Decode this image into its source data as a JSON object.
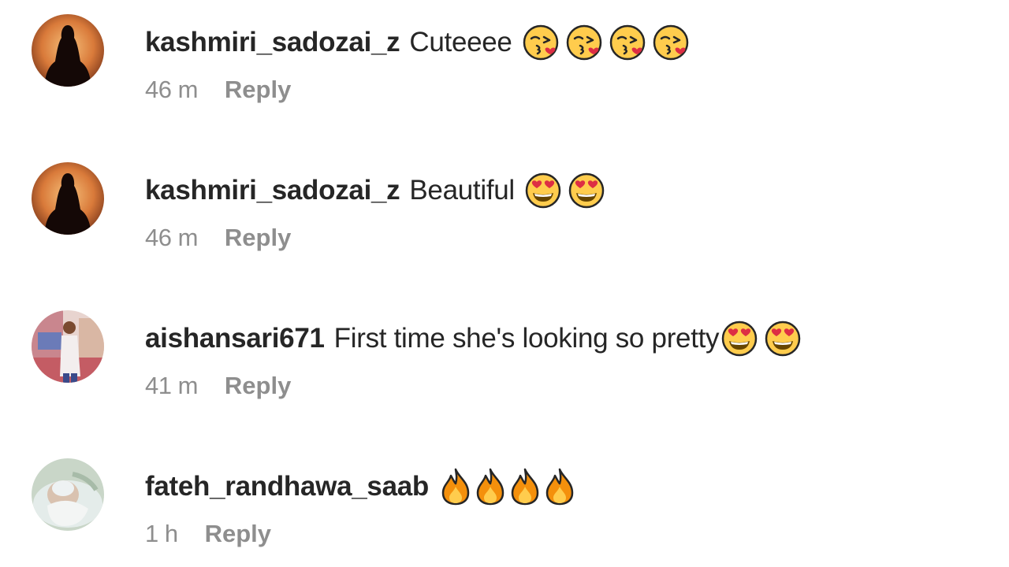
{
  "comments": [
    {
      "username": "kashmiri_sadozai_z",
      "text": "Cuteeee",
      "emoji": "kissing-heart",
      "emoji_count": 4,
      "time": "46 m",
      "reply_label": "Reply"
    },
    {
      "username": "kashmiri_sadozai_z",
      "text": "Beautiful",
      "emoji": "heart-eyes",
      "emoji_count": 2,
      "time": "46 m",
      "reply_label": "Reply"
    },
    {
      "username": "aishansari671",
      "text": "First time she's looking so pretty",
      "emoji": "heart-eyes",
      "emoji_count": 2,
      "time": "41 m",
      "reply_label": "Reply"
    },
    {
      "username": "fateh_randhawa_saab",
      "text": "",
      "emoji": "fire",
      "emoji_count": 4,
      "time": "1 h",
      "reply_label": "Reply"
    }
  ],
  "colors": {
    "username": "#262626",
    "meta": "#8e8e8e",
    "background": "#ffffff"
  }
}
